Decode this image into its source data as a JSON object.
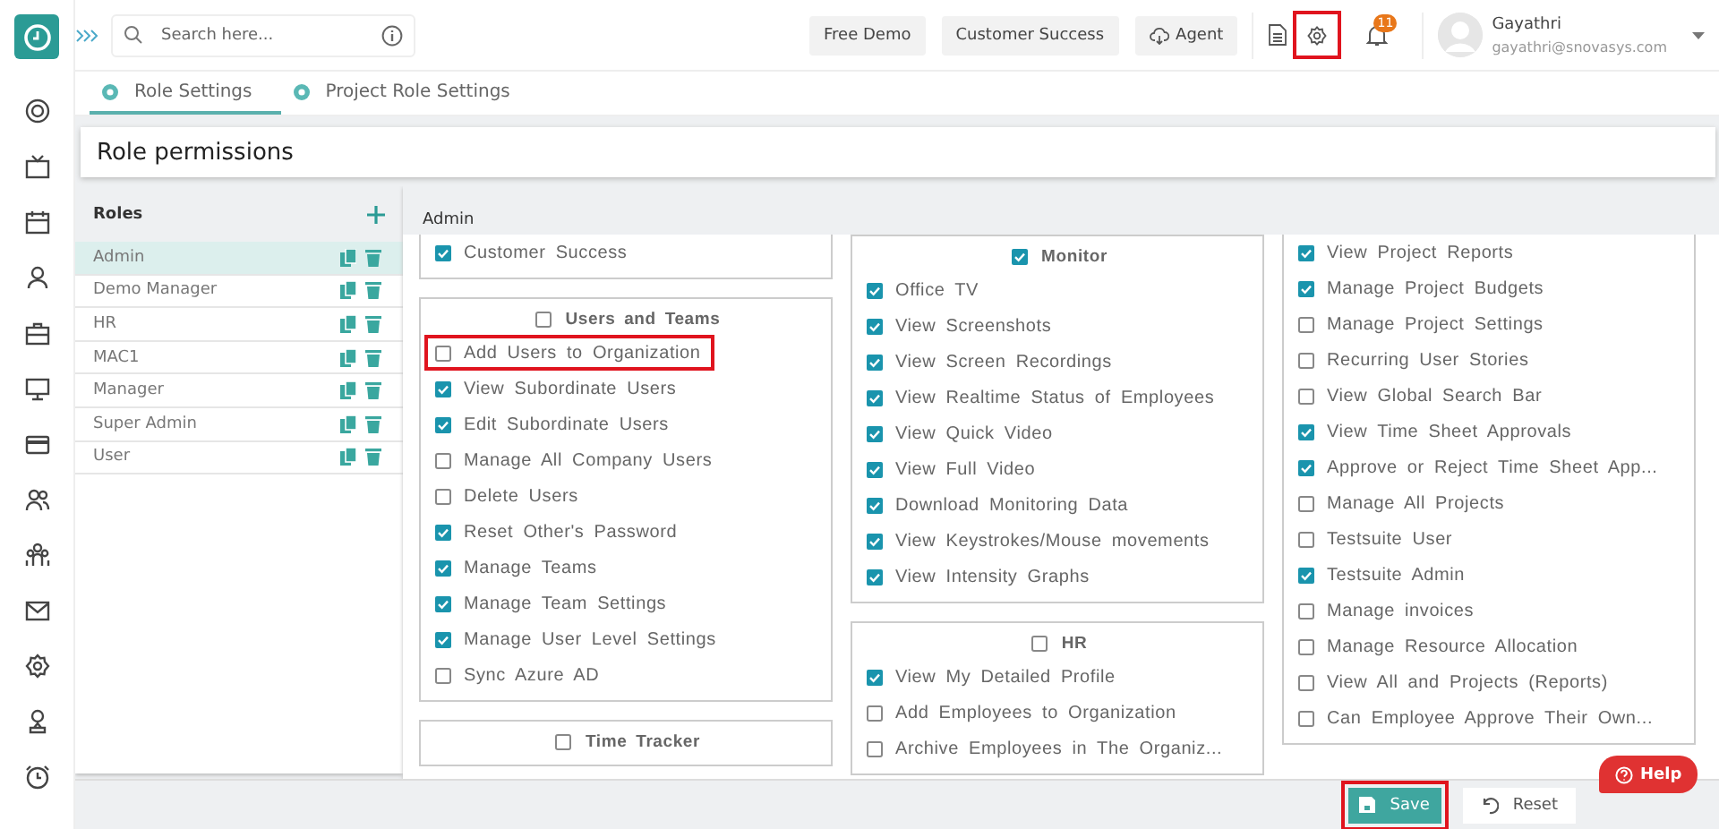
{
  "topbar": {
    "search": {
      "placeholder": "Search here..."
    },
    "buttons": [
      {
        "label": "Free Demo",
        "kind": "plain"
      },
      {
        "label": "Customer Success",
        "kind": "plain"
      },
      {
        "label": "Agent",
        "kind": "cloud"
      }
    ],
    "settings": {
      "highlighted": true
    },
    "notifications": {
      "count": "11"
    },
    "user": {
      "name": "Gayathri",
      "email": "gayathri@snovasys.com"
    }
  },
  "tabs": [
    {
      "label": "Role Settings",
      "selected": true
    },
    {
      "label": "Project Role Settings",
      "selected": false
    }
  ],
  "page_title": "Role permissions",
  "roles": {
    "title": "Roles",
    "items": [
      {
        "name": "Admin",
        "selected": true
      },
      {
        "name": "Demo Manager",
        "selected": false
      },
      {
        "name": "HR",
        "selected": false
      },
      {
        "name": "MAC1",
        "selected": false
      },
      {
        "name": "Manager",
        "selected": false
      },
      {
        "name": "Super Admin",
        "selected": false
      },
      {
        "name": "User",
        "selected": false
      }
    ]
  },
  "role_name": {
    "value": "Admin"
  },
  "permission_columns": [
    {
      "groups": [
        {
          "items": [
            {
              "label": "Customer Success",
              "checked": true,
              "highlighted": false
            }
          ]
        },
        {
          "title": "Users and Teams",
          "checked": false,
          "items": [
            {
              "label": "Add Users to Organization",
              "checked": false,
              "highlighted": true
            },
            {
              "label": "View Subordinate Users",
              "checked": true,
              "highlighted": false
            },
            {
              "label": "Edit Subordinate Users",
              "checked": true,
              "highlighted": false
            },
            {
              "label": "Manage All Company Users",
              "checked": false,
              "highlighted": false
            },
            {
              "label": "Delete Users",
              "checked": false,
              "highlighted": false
            },
            {
              "label": "Reset Other's Password",
              "checked": true,
              "highlighted": false
            },
            {
              "label": "Manage Teams",
              "checked": true,
              "highlighted": false
            },
            {
              "label": "Manage Team Settings",
              "checked": true,
              "highlighted": false
            },
            {
              "label": "Manage User Level Settings",
              "checked": true,
              "highlighted": false
            },
            {
              "label": "Sync Azure AD",
              "checked": false,
              "highlighted": false
            }
          ]
        },
        {
          "title": "Time Tracker",
          "checked": false
        }
      ]
    },
    {
      "groups": [
        {
          "title": "Monitor",
          "checked": true,
          "items": [
            {
              "label": "Office TV",
              "checked": true,
              "highlighted": false
            },
            {
              "label": "View Screenshots",
              "checked": true,
              "highlighted": false
            },
            {
              "label": "View Screen Recordings",
              "checked": true,
              "highlighted": false
            },
            {
              "label": "View Realtime Status of Employees",
              "checked": true,
              "highlighted": false
            },
            {
              "label": "View Quick Video",
              "checked": true,
              "highlighted": false
            },
            {
              "label": "View Full Video",
              "checked": true,
              "highlighted": false
            },
            {
              "label": "Download Monitoring Data",
              "checked": true,
              "highlighted": false
            },
            {
              "label": "View Keystrokes/Mouse movements",
              "checked": true,
              "highlighted": false
            },
            {
              "label": "View Intensity Graphs",
              "checked": true,
              "highlighted": false
            }
          ]
        },
        {
          "title": "HR",
          "checked": false,
          "items": [
            {
              "label": "View My Detailed Profile",
              "checked": true,
              "highlighted": false
            },
            {
              "label": "Add Employees to Organization",
              "checked": false,
              "highlighted": false
            },
            {
              "label": "Archive Employees in The Organiz...",
              "checked": false,
              "highlighted": false
            }
          ]
        }
      ]
    },
    {
      "groups": [
        {
          "items": [
            {
              "label": "View Project Reports",
              "checked": true,
              "highlighted": false
            },
            {
              "label": "Manage Project Budgets",
              "checked": true,
              "highlighted": false
            },
            {
              "label": "Manage Project Settings",
              "checked": false,
              "highlighted": false
            },
            {
              "label": "Recurring User Stories",
              "checked": false,
              "highlighted": false
            },
            {
              "label": "View Global Search Bar",
              "checked": false,
              "highlighted": false
            },
            {
              "label": "View Time Sheet Approvals",
              "checked": true,
              "highlighted": false
            },
            {
              "label": "Approve or Reject Time Sheet App...",
              "checked": true,
              "highlighted": false
            },
            {
              "label": "Manage All Projects",
              "checked": false,
              "highlighted": false
            },
            {
              "label": "Testsuite User",
              "checked": false,
              "highlighted": false
            },
            {
              "label": "Testsuite Admin",
              "checked": true,
              "highlighted": false
            },
            {
              "label": "Manage invoices",
              "checked": false,
              "highlighted": false
            },
            {
              "label": "Manage Resource Allocation",
              "checked": false,
              "highlighted": false
            },
            {
              "label": "View All and Projects (Reports)",
              "checked": false,
              "highlighted": false
            },
            {
              "label": "Can Employee Approve Their Own...",
              "checked": false,
              "highlighted": false
            }
          ]
        }
      ]
    }
  ],
  "footer": {
    "save": {
      "label": "Save",
      "highlighted": true
    },
    "reset": {
      "label": "Reset"
    },
    "help": {
      "label": "Help"
    }
  }
}
